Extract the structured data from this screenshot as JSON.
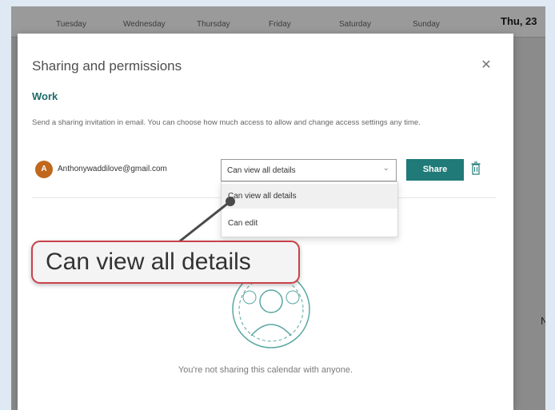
{
  "calendar_header": {
    "days": [
      "Tuesday",
      "Wednesday",
      "Thursday",
      "Friday",
      "Saturday",
      "Sunday"
    ],
    "current_day": "Thu, 23",
    "right_edge_letter": "N"
  },
  "dialog": {
    "title": "Sharing and permissions",
    "close_icon": "close-icon",
    "calendar_name": "Work",
    "description": "Send a sharing invitation in email. You can choose how much access to allow and change access settings any time.",
    "recipient": {
      "avatar_initial": "A",
      "avatar_color": "#c0681d",
      "email": "Anthonywaddilove@gmail.com"
    },
    "permission_select": {
      "value": "Can view all details",
      "options": [
        "Can view all details",
        "Can edit"
      ]
    },
    "share_button": "Share",
    "accent_color": "#1f7a78",
    "empty_message": "You're not sharing this calendar with anyone."
  },
  "callout": {
    "text": "Can view all details",
    "border_color": "#c9424b"
  }
}
